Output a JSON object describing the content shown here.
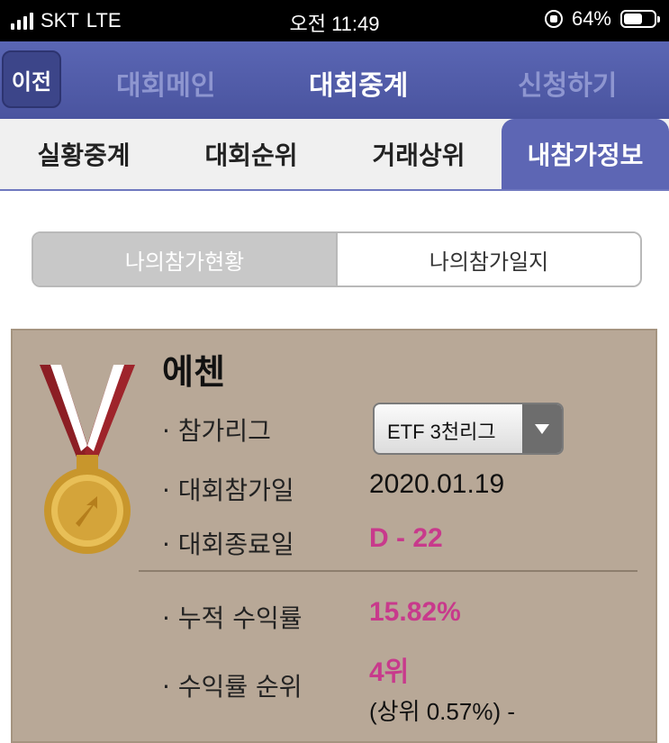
{
  "status_bar": {
    "carrier": "SKT",
    "network": "LTE",
    "time": "오전 11:49",
    "battery": "64%",
    "battery_level": 0.64
  },
  "nav": {
    "back_label": "이전",
    "items": [
      "대회메인",
      "대회중계",
      "신청하기"
    ],
    "active_item": "대회중계"
  },
  "tabs": {
    "items": [
      "실황중계",
      "대회순위",
      "거래상위",
      "내참가정보"
    ],
    "active": "내참가정보"
  },
  "segment": {
    "items": [
      "나의참가현황",
      "나의참가일지"
    ],
    "active": "나의참가현황"
  },
  "profile": {
    "name": "에첸",
    "league_label": "· 참가리그",
    "league_value": "ETF 3천리그",
    "join_label": "· 대회참가일",
    "join_value": "2020.01.19",
    "end_label": "· 대회종료일",
    "end_value": "D - 22",
    "return_label": "· 누적 수익률",
    "return_value": "15.82%",
    "rank_label": "· 수익률 순위",
    "rank_value": "4위",
    "rank_percentile": "(상위 0.57%) -"
  },
  "colors": {
    "nav_bg": "#4f5aa6",
    "active_tab": "#5d66b4",
    "card_bg": "#b8a897",
    "accent_pink": "#c83a8c"
  },
  "icons": [
    "signal-icon",
    "screen-lock-icon",
    "battery-icon",
    "medal-icon",
    "dropdown-arrow-icon"
  ]
}
